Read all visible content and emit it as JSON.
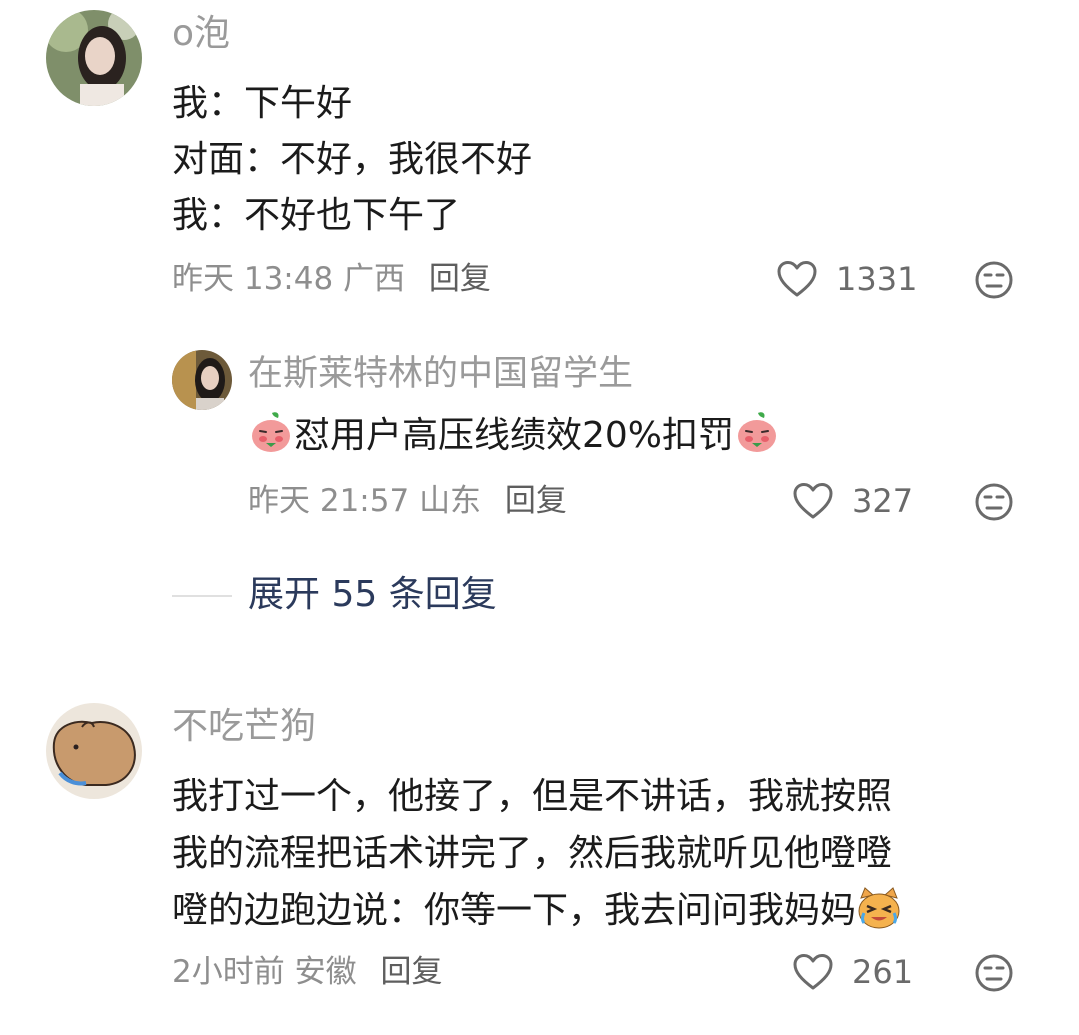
{
  "comments": [
    {
      "username": "o泡",
      "lines": [
        "我：下午好",
        "对面：不好，我很不好",
        "我：不好也下午了"
      ],
      "time": "昨天 13:48",
      "location": "广西",
      "reply_label": "回复",
      "likes": "1331",
      "reply": {
        "username": "在斯莱特林的中国留学生",
        "text": "怼用户高压线绩效20%扣罚",
        "time": "昨天 21:57",
        "location": "山东",
        "reply_label": "回复",
        "likes": "327"
      },
      "expand_label": "展开 55 条回复"
    },
    {
      "username": "不吃芒狗",
      "lines": [
        "我打过一个，他接了，但是不讲话，我就按照",
        "我的流程把话术讲完了，然后我就听见他噔噔",
        "噔的边跑边说：你等一下，我去问问我妈妈"
      ],
      "time": "2小时前",
      "location": "安徽",
      "reply_label": "回复",
      "likes": "261"
    }
  ],
  "colors": {
    "expand_text": "#2b3a5c",
    "meta_text": "#8e8e8e",
    "body_text": "#1b1b1b"
  },
  "icons": [
    "heart-outline-icon",
    "dislike-face-icon",
    "peach-sticker-emoji",
    "crying-cat-emoji"
  ]
}
